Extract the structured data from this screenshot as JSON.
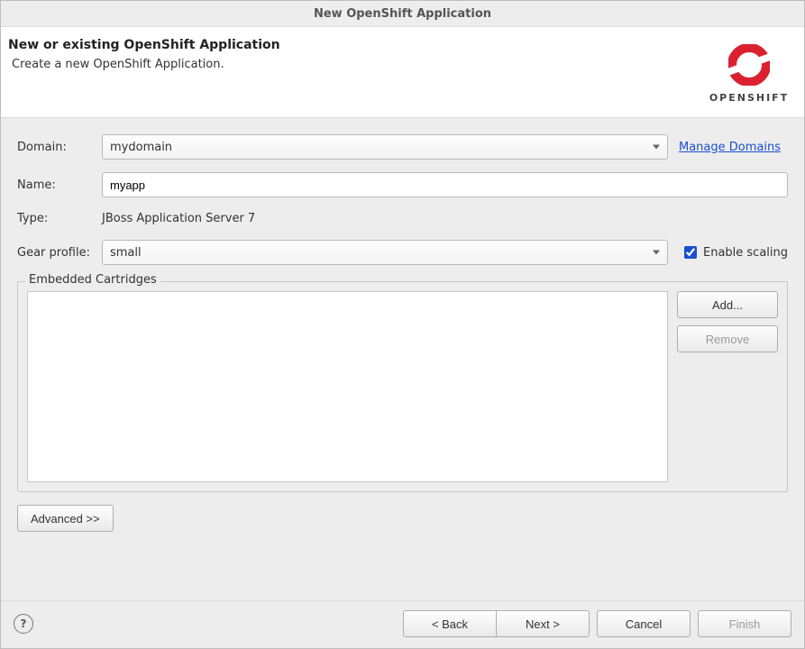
{
  "window": {
    "title": "New OpenShift Application"
  },
  "banner": {
    "title": "New or existing OpenShift Application",
    "subtitle": "Create a new OpenShift Application.",
    "brand": "OPENSHIFT"
  },
  "form": {
    "domain_label": "Domain:",
    "domain_value": "mydomain",
    "manage_domains": "Manage Domains",
    "name_label": "Name:",
    "name_value": "myapp",
    "type_label": "Type:",
    "type_value": "JBoss Application Server 7",
    "gear_label": "Gear profile:",
    "gear_value": "small",
    "enable_scaling_label": "Enable scaling",
    "enable_scaling_checked": true
  },
  "cartridges": {
    "legend": "Embedded Cartridges",
    "add_label": "Add...",
    "remove_label": "Remove"
  },
  "advanced": {
    "label": "Advanced >>"
  },
  "footer": {
    "back": "< Back",
    "next": "Next >",
    "cancel": "Cancel",
    "finish": "Finish"
  }
}
